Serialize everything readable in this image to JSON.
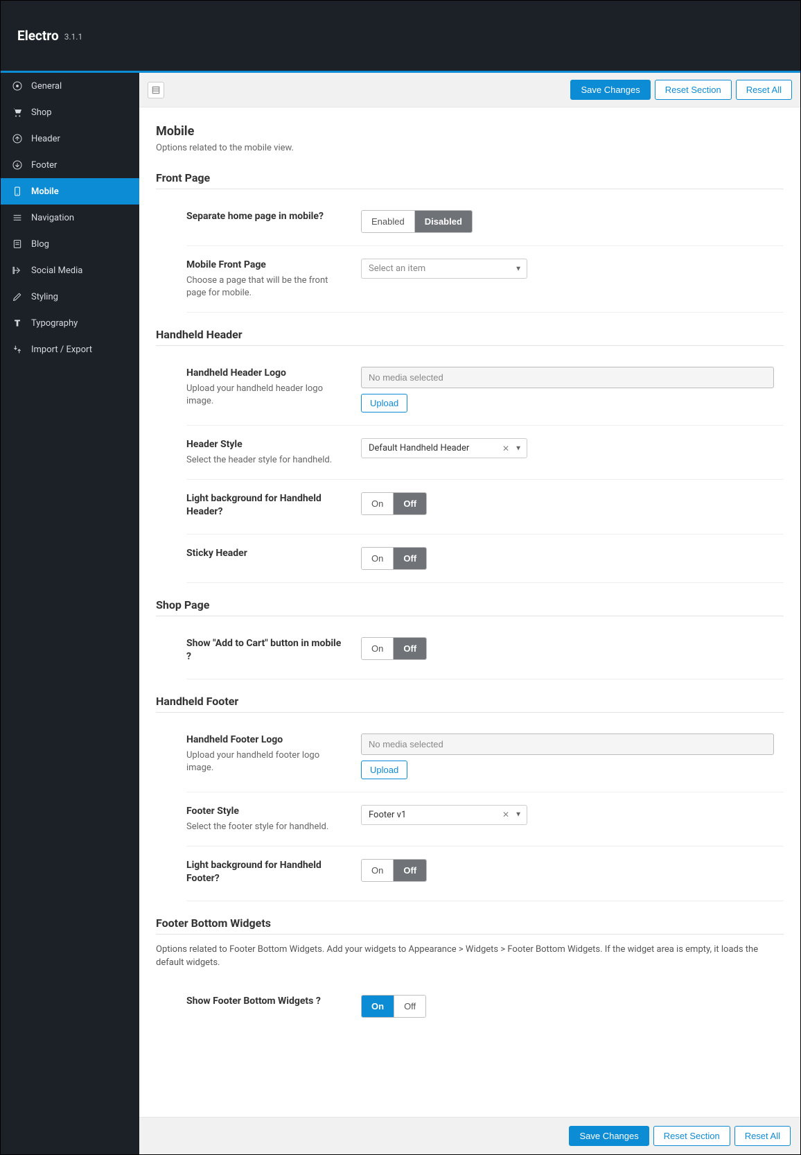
{
  "header": {
    "title": "Electro",
    "version": "3.1.1"
  },
  "sidebar": {
    "items": [
      {
        "label": "General"
      },
      {
        "label": "Shop"
      },
      {
        "label": "Header"
      },
      {
        "label": "Footer"
      },
      {
        "label": "Mobile"
      },
      {
        "label": "Navigation"
      },
      {
        "label": "Blog"
      },
      {
        "label": "Social Media"
      },
      {
        "label": "Styling"
      },
      {
        "label": "Typography"
      },
      {
        "label": "Import / Export"
      }
    ],
    "active_index": 4
  },
  "toolbar": {
    "save": "Save Changes",
    "reset_section": "Reset Section",
    "reset_all": "Reset All"
  },
  "page": {
    "title": "Mobile",
    "desc": "Options related to the mobile view."
  },
  "toggles": {
    "enabled": "Enabled",
    "disabled": "Disabled",
    "on": "On",
    "off": "Off"
  },
  "sections": {
    "front_page": {
      "heading": "Front Page",
      "separate": {
        "label": "Separate home page in mobile?",
        "value": "Disabled"
      },
      "mobile_front_page": {
        "label": "Mobile Front Page",
        "sub": "Choose a page that will be the front page for mobile.",
        "placeholder": "Select an item"
      }
    },
    "handheld_header": {
      "heading": "Handheld Header",
      "logo": {
        "label": "Handheld Header Logo",
        "sub": "Upload your handheld header logo image.",
        "value": "No media selected",
        "upload": "Upload"
      },
      "style": {
        "label": "Header Style",
        "sub": "Select the header style for handheld.",
        "value": "Default Handheld Header"
      },
      "light_bg": {
        "label": "Light background for Handheld Header?",
        "value": "Off"
      },
      "sticky": {
        "label": "Sticky Header",
        "value": "Off"
      }
    },
    "shop_page": {
      "heading": "Shop Page",
      "add_to_cart": {
        "label": "Show \"Add to Cart\" button in mobile ?",
        "value": "Off"
      }
    },
    "handheld_footer": {
      "heading": "Handheld Footer",
      "logo": {
        "label": "Handheld Footer Logo",
        "sub": "Upload your handheld footer logo image.",
        "value": "No media selected",
        "upload": "Upload"
      },
      "style": {
        "label": "Footer Style",
        "sub": "Select the footer style for handheld.",
        "value": "Footer v1"
      },
      "light_bg": {
        "label": "Light background for Handheld Footer?",
        "value": "Off"
      }
    },
    "footer_widgets": {
      "heading": "Footer Bottom Widgets",
      "note": "Options related to Footer Bottom Widgets. Add your widgets to Appearance > Widgets > Footer Bottom Widgets. If the widget area is empty, it loads the default widgets.",
      "show": {
        "label": "Show Footer Bottom Widgets ?",
        "value": "On"
      }
    }
  },
  "colors": {
    "accent": "#0d8cd6"
  }
}
